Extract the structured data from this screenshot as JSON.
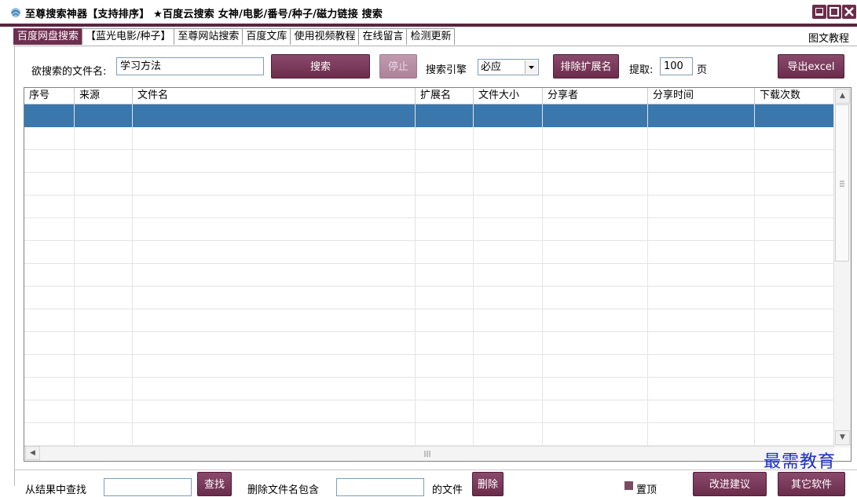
{
  "app": {
    "title": "至尊搜索神器【支持排序】 ★百度云搜索  女神/电影/番号/种子/磁力链接  搜索"
  },
  "tabs": [
    {
      "label": "百度网盘搜索",
      "active": true
    },
    {
      "label": "【蓝光电影/种子】",
      "active": false
    },
    {
      "label": "至尊网站搜索",
      "active": false
    },
    {
      "label": "百度文库",
      "active": false
    },
    {
      "label": "使用视频教程",
      "active": false
    },
    {
      "label": "在线留言",
      "active": false
    },
    {
      "label": "检测更新",
      "active": false
    }
  ],
  "tutorial_link": "图文教程",
  "search": {
    "filename_label": "欲搜索的文件名:",
    "filename_value": "学习方法",
    "search_button": "搜索",
    "stop_button": "停止",
    "engine_label": "搜索引擎",
    "engine_value": "必应",
    "exclude_ext_button": "排除扩展名",
    "fetch_label": "提取:",
    "fetch_value": "100",
    "page_label": "页",
    "export_button": "导出excel"
  },
  "grid": {
    "columns": [
      "序号",
      "来源",
      "文件名",
      "扩展名",
      "文件大小",
      "分享者",
      "分享时间",
      "下载次数"
    ],
    "selected_row_index": 0,
    "empty_row_count": 15
  },
  "bottom": {
    "find_label": "从结果中查找",
    "find_button": "查找",
    "delete_label": "删除文件名包含",
    "delete_suffix": "的文件",
    "delete_button": "删除",
    "pin_label": "置顶",
    "feedback_button": "改进建议",
    "other_button": "其它软件"
  },
  "watermark": "最需教育",
  "colors": {
    "accent": "#6d2f50",
    "selection": "#3a77ad"
  }
}
